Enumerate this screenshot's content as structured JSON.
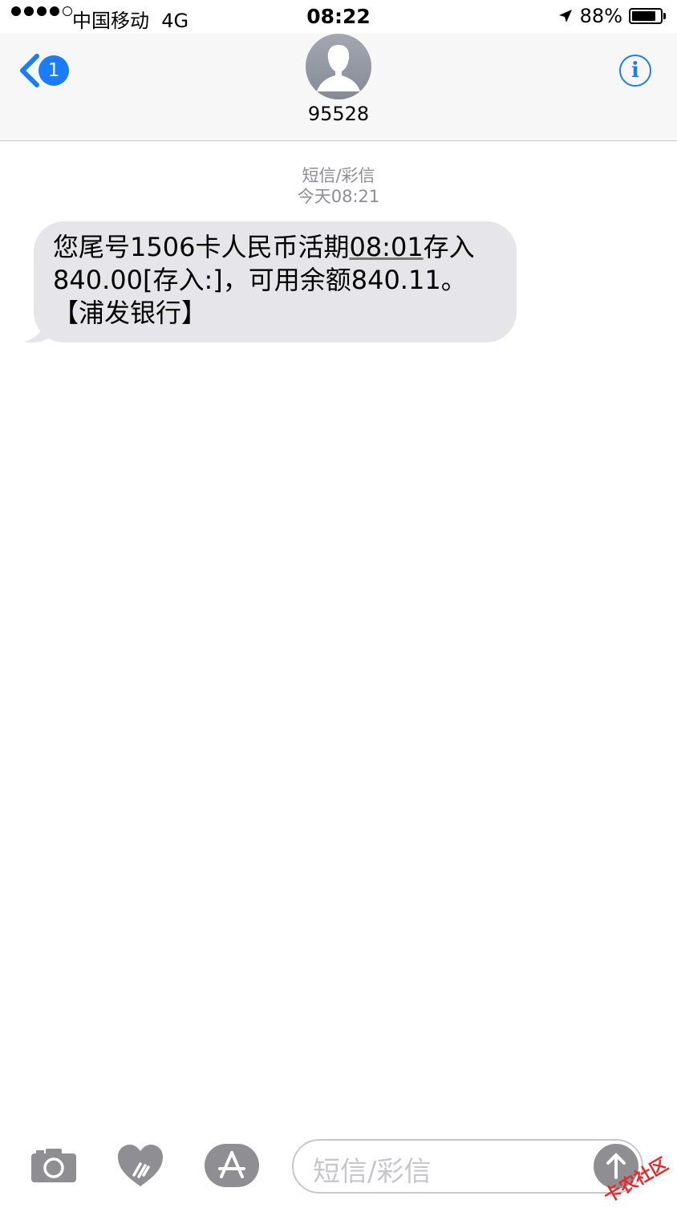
{
  "status_bar": {
    "carrier": "中国移动",
    "network": "4G",
    "time": "08:22",
    "battery_percent": "88%",
    "battery_level": 0.88,
    "signal_bars": 4,
    "signal_total": 5
  },
  "nav": {
    "back_badge": "1",
    "contact_name": "95528",
    "info_label": "i"
  },
  "conversation": {
    "service_label": "短信/彩信",
    "timestamp": "今天08:21",
    "message": {
      "line1_pre": "您尾号1506卡人民币活期",
      "line1_link": "08:01",
      "line1_post": "存入",
      "line2": "840.00[存入:]，可用余额840.11。",
      "line3": "【浦发银行】"
    }
  },
  "toolbar": {
    "input_placeholder": "短信/彩信",
    "watermark": "卡农社区"
  },
  "colors": {
    "accent": "#1a7cff",
    "bubble": "#e5e5ea",
    "meta_text": "#8e8e93",
    "icon_gray": "#8e8e93"
  }
}
